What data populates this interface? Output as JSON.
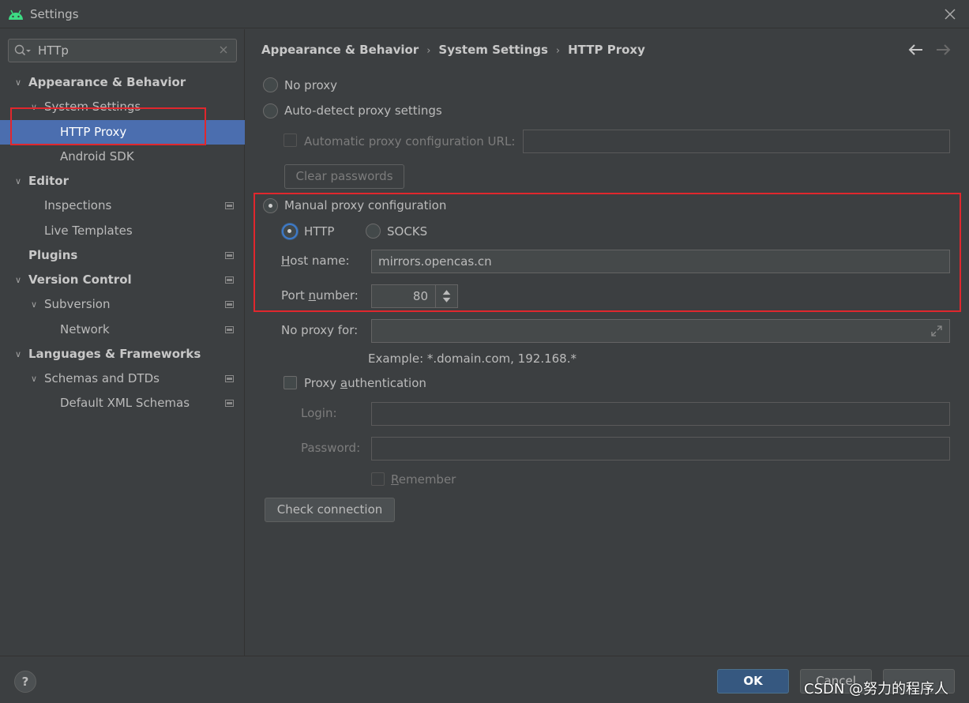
{
  "window": {
    "title": "Settings"
  },
  "sidebar": {
    "search_value": "HTTp",
    "items": [
      {
        "label": "Appearance & Behavior"
      },
      {
        "label": "System Settings"
      },
      {
        "label": "HTTP Proxy"
      },
      {
        "label": "Android SDK"
      },
      {
        "label": "Editor"
      },
      {
        "label": "Inspections"
      },
      {
        "label": "Live Templates"
      },
      {
        "label": "Plugins"
      },
      {
        "label": "Version Control"
      },
      {
        "label": "Subversion"
      },
      {
        "label": "Network"
      },
      {
        "label": "Languages & Frameworks"
      },
      {
        "label": "Schemas and DTDs"
      },
      {
        "label": "Default XML Schemas"
      }
    ]
  },
  "breadcrumb": [
    "Appearance & Behavior",
    "System Settings",
    "HTTP Proxy"
  ],
  "proxy": {
    "no_proxy": "No proxy",
    "auto_detect": "Auto-detect proxy settings",
    "auto_url_label": "Automatic proxy configuration URL:",
    "clear_passwords": "Clear passwords",
    "manual": "Manual proxy configuration",
    "http": "HTTP",
    "socks": "SOCKS",
    "host_label_u": "H",
    "host_label_rest": "ost name:",
    "host_value": "mirrors.opencas.cn",
    "port_label_a": "Port ",
    "port_label_u": "n",
    "port_label_b": "umber:",
    "port_value": "80",
    "no_proxy_for": "No proxy for:",
    "example": "Example: *.domain.com, 192.168.*",
    "auth_a": "Proxy ",
    "auth_u": "a",
    "auth_b": "uthentication",
    "login": "Login:",
    "password": "Password:",
    "remember_u": "R",
    "remember_rest": "emember",
    "check_connection": "Check connection"
  },
  "footer": {
    "help": "?",
    "ok": "OK",
    "cancel": "Cancel",
    "watermark": "CSDN @努力的程序人"
  },
  "colors": {
    "background": "#3c3f41",
    "selection": "#4b6eaf",
    "annotation_box": "#e0272d",
    "primary_button": "#365880"
  }
}
